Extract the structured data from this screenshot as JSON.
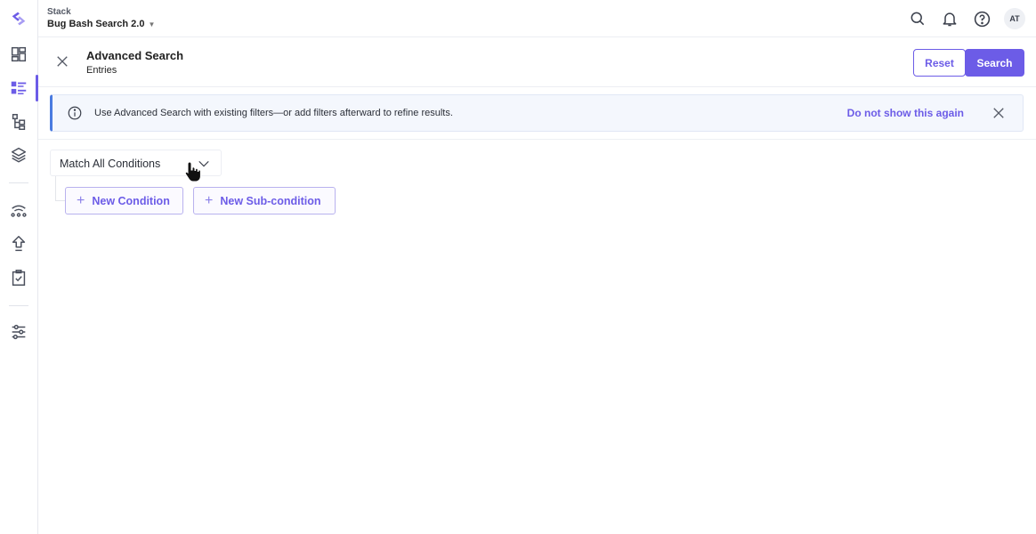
{
  "app": {
    "stack_label": "Stack",
    "stack_name": "Bug Bash Search 2.0",
    "avatar_initials": "AT",
    "accent_color": "#6c5ce7"
  },
  "sidebar": {
    "items": [
      {
        "name": "logo",
        "icon": "brand-logo-icon"
      },
      {
        "name": "dashboard",
        "icon": "dashboard-icon"
      },
      {
        "name": "entries",
        "icon": "entries-list-icon",
        "active": true
      },
      {
        "name": "content-models",
        "icon": "content-models-icon"
      },
      {
        "name": "assets",
        "icon": "layers-icon"
      },
      {
        "name": "releases",
        "icon": "releases-icon"
      },
      {
        "name": "publish-queue",
        "icon": "upload-arrow-icon"
      },
      {
        "name": "tasks",
        "icon": "clipboard-check-icon"
      },
      {
        "name": "settings",
        "icon": "sliders-icon"
      }
    ]
  },
  "header": {
    "title": "Advanced Search",
    "subtitle": "Entries",
    "reset_label": "Reset",
    "search_label": "Search"
  },
  "banner": {
    "text": "Use Advanced Search with existing filters—or add filters afterward to refine results.",
    "dismiss_label": "Do not show this again"
  },
  "conditions": {
    "match_value": "Match All Conditions",
    "new_condition_label": "New Condition",
    "new_subcondition_label": "New Sub-condition"
  }
}
